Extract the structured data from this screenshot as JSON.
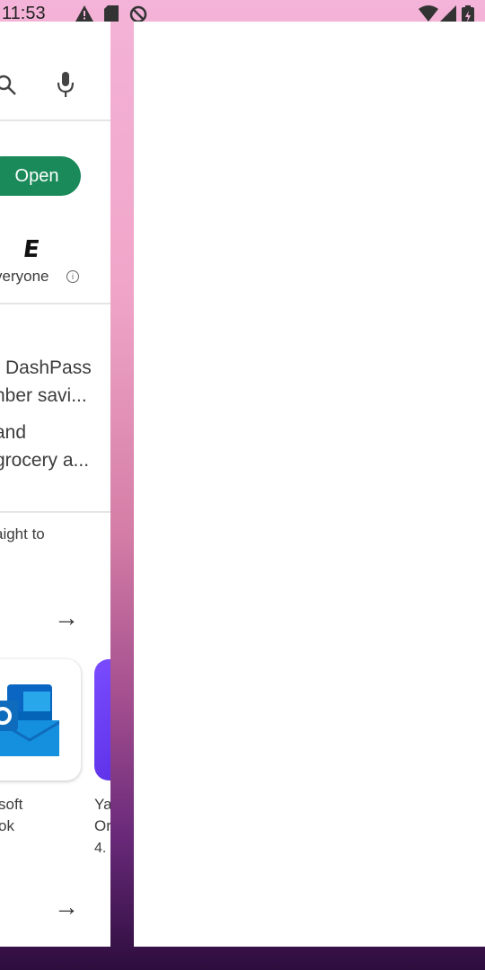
{
  "status_bar": {
    "time": "11:53",
    "icons": [
      "warning-icon",
      "sd-card-icon",
      "no-disturb-icon",
      "wifi-icon",
      "signal-icon",
      "battery-icon"
    ]
  },
  "play_store": {
    "open_button": "Open",
    "rating_label": "veryone",
    "esrb_letter": "E",
    "promo_line1": "DashPass",
    "promo_line2": "nber savi...",
    "promo_line3": "and",
    "promo_line4": "grocery a...",
    "section_text": "aight to",
    "app1_name_line1": "soft",
    "app1_name_line2": "ok",
    "app2_name_line1": "Ya",
    "app2_name_line2": "Or",
    "app2_rating": "4."
  },
  "colors": {
    "open_button_bg": "#1a8a5a",
    "wallpaper_top": "#f4b3d8",
    "wallpaper_bottom": "#2d0d3e"
  }
}
